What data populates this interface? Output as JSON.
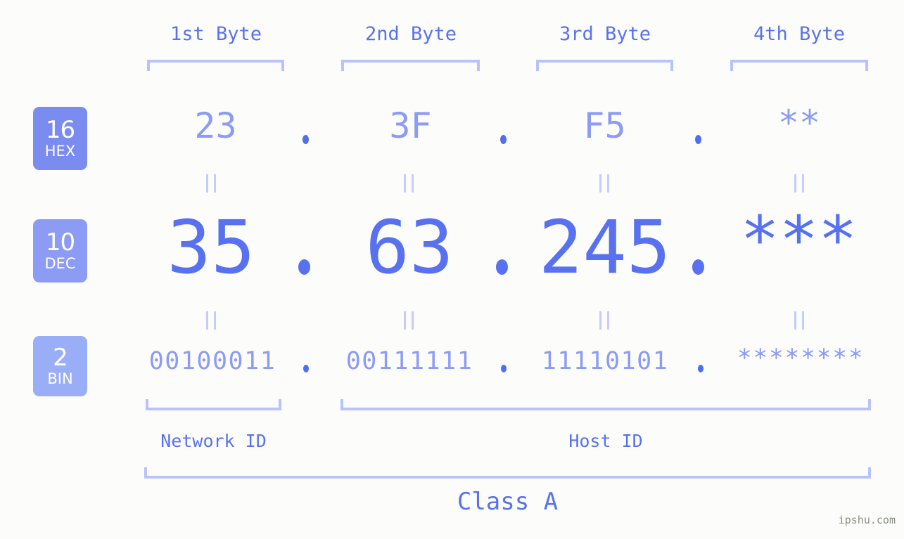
{
  "meta": {
    "background_color": "#fcfdfa",
    "accent_color": "#5871f0",
    "light_accent_color": "#8c9bf4",
    "bracket_color": "#b8c3fb",
    "watermark": "ipshu.com"
  },
  "byte_headers": [
    {
      "label": "1st Byte"
    },
    {
      "label": "2nd Byte"
    },
    {
      "label": "3rd Byte"
    },
    {
      "label": "4th Byte"
    }
  ],
  "bases": [
    {
      "number": "16",
      "name": "HEX",
      "color": "#7b8cf0"
    },
    {
      "number": "10",
      "name": "DEC",
      "color": "#8c9bf4"
    },
    {
      "number": "2",
      "name": "BIN",
      "color": "#9aaef8"
    }
  ],
  "rows": {
    "hex": {
      "values": [
        "23",
        "3F",
        "F5",
        "**"
      ],
      "separator": "."
    },
    "dec": {
      "values": [
        "35",
        "63",
        "245",
        "***"
      ],
      "separator": "."
    },
    "bin": {
      "values": [
        "00100011",
        "00111111",
        "11110101",
        "********"
      ],
      "separator": "."
    }
  },
  "equals_symbol": "=",
  "sections": [
    {
      "label": "Network ID"
    },
    {
      "label": "Host ID"
    }
  ],
  "class": {
    "label": "Class A"
  },
  "ip": {
    "hex": "23.3F.F5.**",
    "dec": "35.63.245.***",
    "bin": "00100011.00111111.11110101.********"
  }
}
